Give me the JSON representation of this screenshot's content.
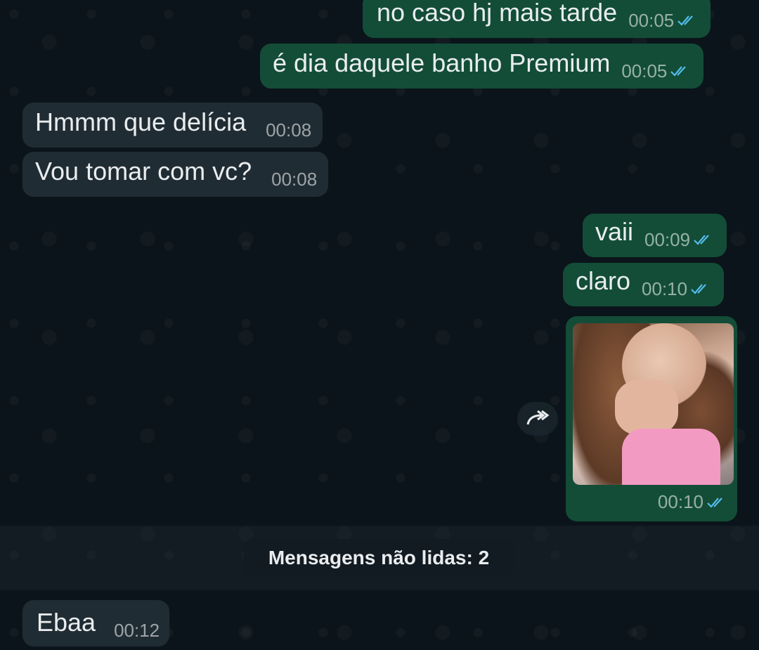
{
  "messages": [
    {
      "text": "no caso hj mais tarde",
      "time": "00:05"
    },
    {
      "text": "é dia daquele banho Premium",
      "time": "00:05"
    },
    {
      "text": "Hmmm que delícia",
      "time": "00:08"
    },
    {
      "text": "Vou tomar com vc?",
      "time": "00:08"
    },
    {
      "text": "vaii",
      "time": "00:09"
    },
    {
      "text": "claro",
      "time": "00:10"
    },
    {
      "text": "Ebaa",
      "time": "00:12"
    }
  ],
  "image_message": {
    "time": "00:10"
  },
  "unread_divider": {
    "label": "Mensagens não lidas: 2"
  },
  "colors": {
    "outgoing_bubble": "#134d37",
    "incoming_bubble": "#202c33",
    "read_ticks": "#53bdeb",
    "background": "#0b141a"
  },
  "icons": {
    "read_receipt": "double-check-icon",
    "forward": "forward-arrow-icon"
  }
}
